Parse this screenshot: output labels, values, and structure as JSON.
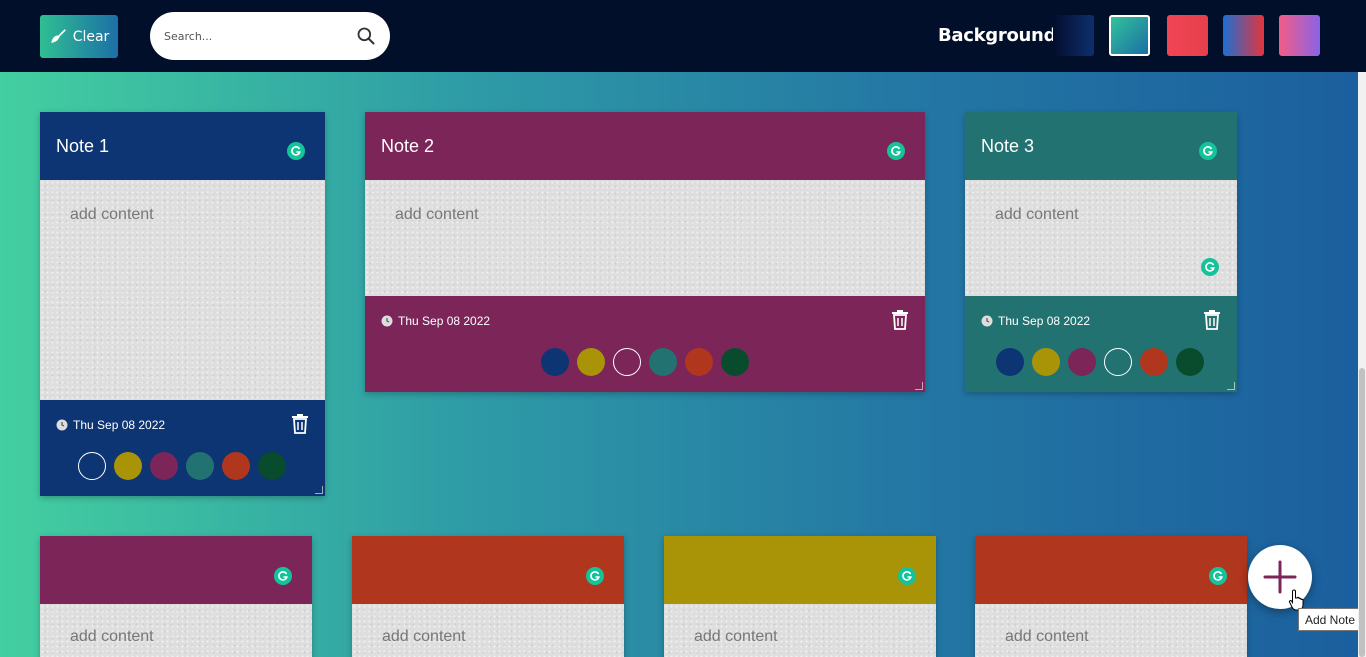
{
  "toolbar": {
    "clear_label": "Clear",
    "search_placeholder": "Search...",
    "background_label": "Background",
    "swatches": [
      {
        "name": "navy",
        "gradient": "linear-gradient(90deg,#030d2c,#0d2f6e)"
      },
      {
        "name": "teal",
        "gradient": "linear-gradient(135deg,#32c29a,#1c6ea6)"
      },
      {
        "name": "red",
        "gradient": "linear-gradient(90deg,#f14455,#e6404c)"
      },
      {
        "name": "blue-red",
        "gradient": "linear-gradient(90deg,#1d6fd1,#e4343e)"
      },
      {
        "name": "pink-violet",
        "gradient": "linear-gradient(90deg,#f25c86,#8a63e6)"
      }
    ],
    "selected_swatch": 1
  },
  "palette": [
    "#0d3473",
    "#a99408",
    "#7b2559",
    "#237272",
    "#b0371d",
    "#084c2d"
  ],
  "notes": [
    {
      "title": "Note 1",
      "content": "add content",
      "date": "Thu Sep 08 2022",
      "color": "#0d3473",
      "selected_dot": 0,
      "show_footer": true
    },
    {
      "title": "Note 2",
      "content": "add content",
      "date": "Thu Sep 08 2022",
      "color": "#7b2559",
      "selected_dot": 2,
      "show_footer": true
    },
    {
      "title": "Note 3",
      "content": "add content",
      "date": "Thu Sep 08 2022",
      "color": "#237272",
      "selected_dot": 3,
      "show_footer": true
    },
    {
      "title": "",
      "content": "add content",
      "color": "#7b2559",
      "show_footer": false
    },
    {
      "title": "",
      "content": "add content",
      "color": "#b0371d",
      "show_footer": false
    },
    {
      "title": "",
      "content": "add content",
      "color": "#a99408",
      "show_footer": false
    },
    {
      "title": "",
      "content": "add content",
      "color": "#b0371d",
      "show_footer": false
    }
  ],
  "add_note": {
    "tooltip": "Add Note",
    "plus_color": "#7b2559"
  },
  "colors": {
    "topbar": "#020f2a",
    "grammarly": "#15c39a"
  }
}
